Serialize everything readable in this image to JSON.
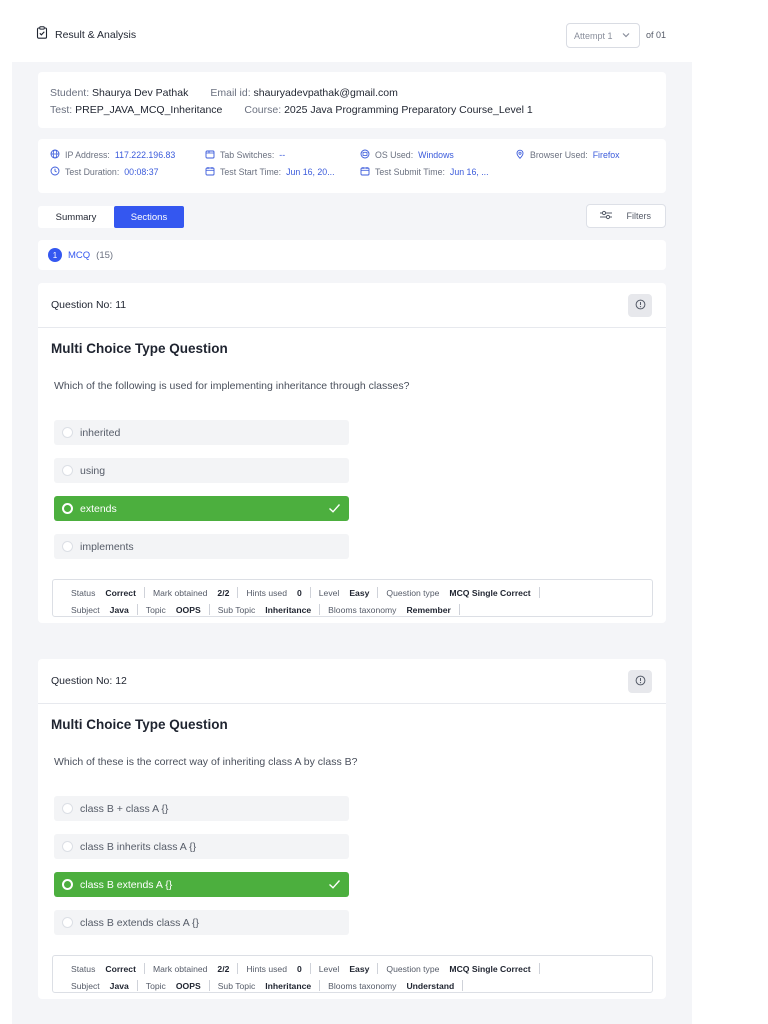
{
  "header": {
    "title": "Result & Analysis",
    "attempt_label": "Attempt 1",
    "attempt_of": "of 01"
  },
  "student": {
    "student_label": "Student:",
    "student_name": "Shaurya Dev Pathak",
    "email_label": "Email id:",
    "email": "shauryadevpathak@gmail.com",
    "test_label": "Test:",
    "test_name": "PREP_JAVA_MCQ_Inheritance",
    "course_label": "Course:",
    "course_name": "2025 Java Programming Preparatory Course_Level 1"
  },
  "meta": {
    "ip_label": "IP Address:",
    "ip_value": "117.222.196.83",
    "tab_label": "Tab Switches:",
    "tab_value": "--",
    "os_label": "OS Used:",
    "os_value": "Windows",
    "browser_label": "Browser Used:",
    "browser_value": "Firefox",
    "duration_label": "Test Duration:",
    "duration_value": "00:08:37",
    "start_label": "Test Start Time:",
    "start_value": "Jun 16, 20...",
    "submit_label": "Test Submit Time:",
    "submit_value": "Jun 16, ..."
  },
  "tabs": {
    "summary": "Summary",
    "sections": "Sections",
    "filters": "Filters"
  },
  "section": {
    "number": "1",
    "name": "MCQ",
    "count": "(15)"
  },
  "questions": [
    {
      "no": "Question No: 11",
      "type": "Multi Choice Type Question",
      "text": "Which of the following is used for implementing inheritance through classes?",
      "options": [
        "inherited",
        "using",
        "extends",
        "implements"
      ],
      "correct_index": 2,
      "stats": {
        "status_label": "Status",
        "status": "Correct",
        "mark_label": "Mark obtained",
        "mark": "2/2",
        "hints_label": "Hints used",
        "hints": "0",
        "level_label": "Level",
        "level": "Easy",
        "qtype_label": "Question type",
        "qtype": "MCQ Single Correct",
        "subject_label": "Subject",
        "subject": "Java",
        "topic_label": "Topic",
        "topic": "OOPS",
        "subtopic_label": "Sub Topic",
        "subtopic": "Inheritance",
        "blooms_label": "Blooms taxonomy",
        "blooms": "Remember"
      }
    },
    {
      "no": "Question No: 12",
      "type": "Multi Choice Type Question",
      "text": "Which of these is the correct way of inheriting class A by class B?",
      "options": [
        "class B + class A {}",
        "class B inherits class A {}",
        "class B extends A {}",
        "class B extends class A {}"
      ],
      "correct_index": 2,
      "stats": {
        "status_label": "Status",
        "status": "Correct",
        "mark_label": "Mark obtained",
        "mark": "2/2",
        "hints_label": "Hints used",
        "hints": "0",
        "level_label": "Level",
        "level": "Easy",
        "qtype_label": "Question type",
        "qtype": "MCQ Single Correct",
        "subject_label": "Subject",
        "subject": "Java",
        "topic_label": "Topic",
        "topic": "OOPS",
        "subtopic_label": "Sub Topic",
        "subtopic": "Inheritance",
        "blooms_label": "Blooms taxonomy",
        "blooms": "Understand"
      }
    }
  ],
  "colors": {
    "accent": "#3457f0",
    "correct": "#4caf3e",
    "panel": "#f4f5f8"
  }
}
